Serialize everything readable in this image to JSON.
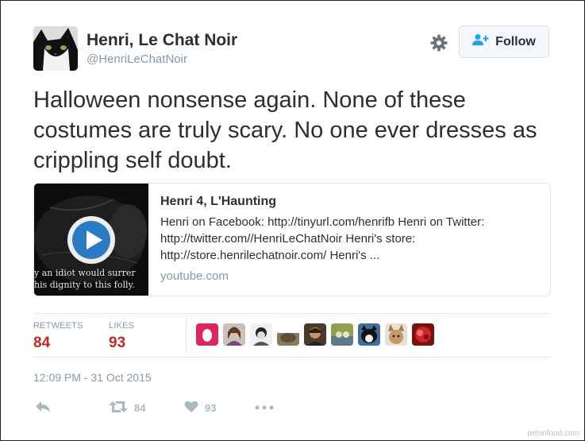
{
  "author": {
    "display_name": "Henri, Le Chat Noir",
    "handle": "@HenriLeChatNoir"
  },
  "header": {
    "follow_label": "Follow"
  },
  "tweet": {
    "text": "Halloween nonsense again. None of these costumes are truly scary. No one ever dresses as crippling self doubt.",
    "timestamp": "12:09 PM - 31 Oct 2015"
  },
  "card": {
    "title": "Henri 4, L'Haunting",
    "description": "Henri on Facebook: http://tinyurl.com/henrifb Henri on Twitter:\nhttp://twitter.com//HenriLeChatNoir Henri's store:\nhttp://store.henrilechatnoir.com/ Henri's ...",
    "domain": "youtube.com",
    "thumbnail_caption": "y an idiot would surrer\nhis dignity to this folly."
  },
  "stats": {
    "retweets_label": "RETWEETS",
    "retweets_value": "84",
    "likes_label": "LIKES",
    "likes_value": "93"
  },
  "actions": {
    "retweet_count": "84",
    "like_count": "93"
  },
  "watermark": "petsnfood.com",
  "colors": {
    "stat_value": "#c8271f",
    "follow_icon": "#1da1f2",
    "play_button": "#2b7bc4",
    "muted_text": "#8899a6"
  }
}
